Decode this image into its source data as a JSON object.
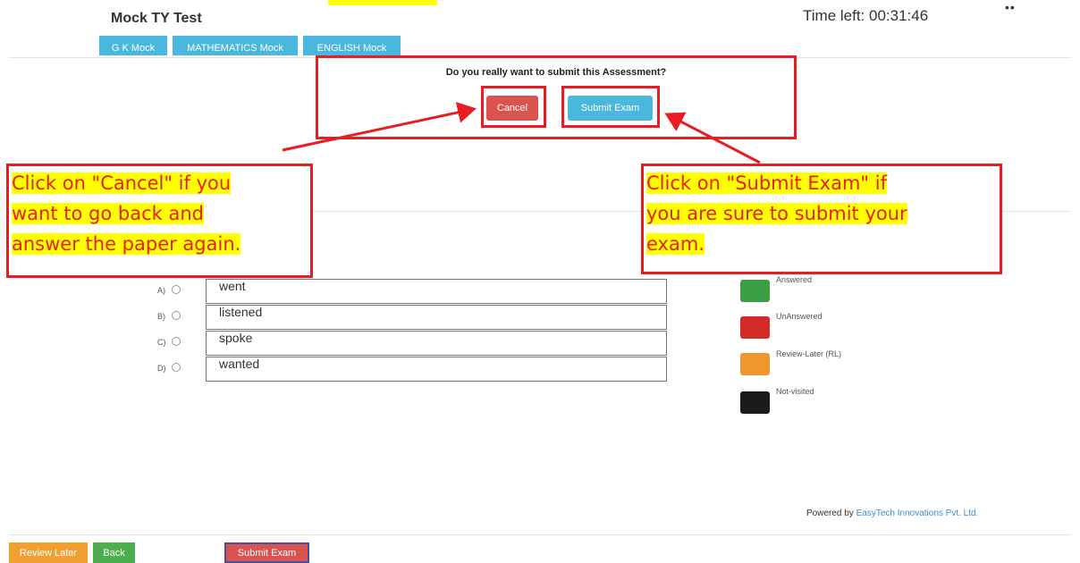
{
  "header": {
    "title": "Mock TY Test",
    "timer": "Time left: 00:31:46",
    "menu_glyph": "••"
  },
  "tabs": [
    {
      "label": "G K Mock"
    },
    {
      "label": "MATHEMATICS Mock"
    },
    {
      "label": "ENGLISH Mock"
    }
  ],
  "modal": {
    "question": "Do you really want to submit this Assessment?",
    "cancel_label": "Cancel",
    "submit_label": "Submit Exam"
  },
  "callouts": {
    "left": [
      "Click on \"Cancel\" if you",
      "want to go back and",
      "answer the paper again."
    ],
    "right": [
      "Click on \"Submit Exam\" if",
      "you are sure to submit your",
      "exam."
    ]
  },
  "options": [
    {
      "letter": "A)",
      "text": "went"
    },
    {
      "letter": "B)",
      "text": "listened"
    },
    {
      "letter": "C)",
      "text": "spoke"
    },
    {
      "letter": "D)",
      "text": "wanted"
    }
  ],
  "legend": [
    {
      "label": "Answered",
      "color": "#3e9e43"
    },
    {
      "label": "UnAnswered",
      "color": "#d42b27"
    },
    {
      "label": "Review-Later (RL)",
      "color": "#f0962e"
    },
    {
      "label": "Not-visited",
      "color": "#1a1a1a"
    }
  ],
  "footer": {
    "powered_prefix": "Powered by ",
    "powered_link": "EasyTech Innovations Pvt. Ltd.",
    "review_label": "Review Later",
    "back_label": "Back",
    "submit_label": "Submit Exam"
  },
  "colors": {
    "annotation_red": "#e81c23",
    "highlight_yellow": "#ffff00",
    "tab_blue": "#4ab8dc"
  }
}
